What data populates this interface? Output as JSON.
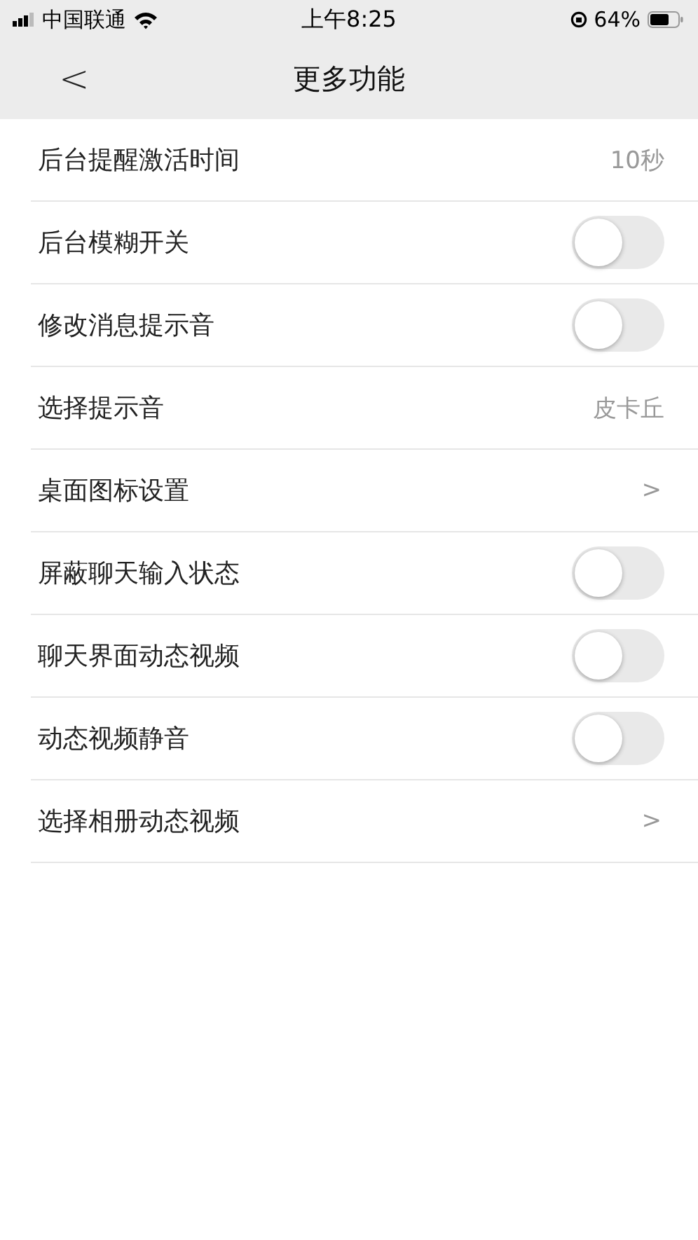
{
  "status_bar": {
    "carrier": "中国联通",
    "time": "上午8:25",
    "battery": "64%"
  },
  "nav": {
    "back": "<",
    "title": "更多功能"
  },
  "rows": [
    {
      "kind": "value",
      "label": "后台提醒激活时间",
      "value": "10秒"
    },
    {
      "kind": "toggle",
      "label": "后台模糊开关",
      "on": false
    },
    {
      "kind": "toggle",
      "label": "修改消息提示音",
      "on": false
    },
    {
      "kind": "value",
      "label": "选择提示音",
      "value": "皮卡丘"
    },
    {
      "kind": "link",
      "label": "桌面图标设置",
      "value": ">"
    },
    {
      "kind": "toggle",
      "label": "屏蔽聊天输入状态",
      "on": false
    },
    {
      "kind": "toggle",
      "label": "聊天界面动态视频",
      "on": false
    },
    {
      "kind": "toggle",
      "label": "动态视频静音",
      "on": false
    },
    {
      "kind": "link",
      "label": "选择相册动态视频",
      "value": ">"
    }
  ]
}
